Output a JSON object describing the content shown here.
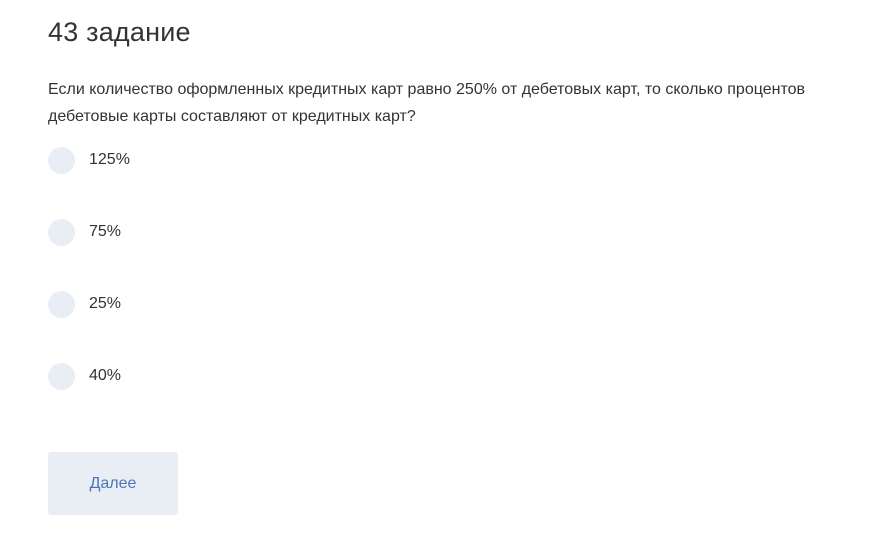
{
  "task": {
    "title": "43 задание",
    "question": "Если количество оформленных кредитных карт равно 250% от дебетовых карт, то сколько процентов дебетовые карты составляют от кредитных карт?",
    "options": [
      {
        "label": "125%"
      },
      {
        "label": "75%"
      },
      {
        "label": "25%"
      },
      {
        "label": "40%"
      }
    ]
  },
  "actions": {
    "next_label": "Далее"
  },
  "colors": {
    "text": "#333333",
    "radio_background": "#e9eef5",
    "button_background": "#e9eef5",
    "button_text": "#4a76b8"
  }
}
